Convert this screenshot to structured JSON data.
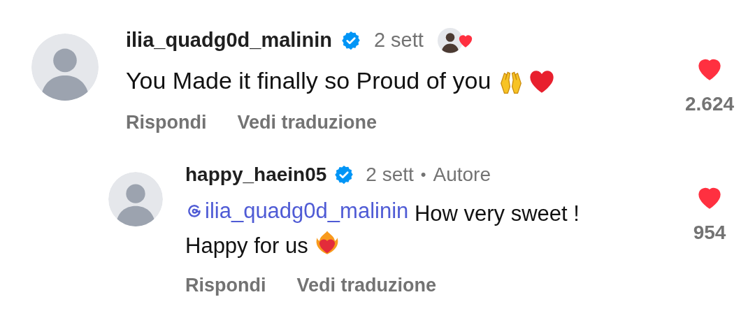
{
  "comments": [
    {
      "username": "ilia_quadg0d_malinin",
      "verified": true,
      "time": "2 sett",
      "liked_by_author": true,
      "text": "You Made it finally so Proud of you",
      "likes": "2.624",
      "liked": true,
      "actions": [
        "Rispondi",
        "Vedi traduzione"
      ],
      "replies": [
        {
          "username": "happy_haein05",
          "verified": true,
          "time": "2 sett",
          "separator": "•",
          "author_label": "Autore",
          "mention": "ilia_quadg0d_malinin",
          "text": "How very sweet ! Happy for us",
          "likes": "954",
          "liked": true,
          "actions": [
            "Rispondi",
            "Vedi traduzione"
          ]
        }
      ]
    }
  ]
}
